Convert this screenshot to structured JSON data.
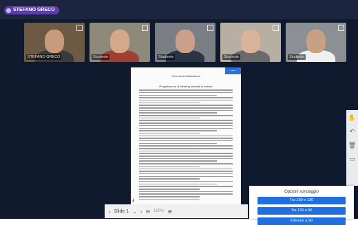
{
  "presenter": {
    "name": "STEFANO GRECO"
  },
  "participants": [
    {
      "name": "STEFANO GRECO",
      "bg": "#6d5a44",
      "skin": "#c89b7b",
      "shirt": "#3a3a3a"
    },
    {
      "name": "Studente",
      "bg": "#8d8a7c",
      "skin": "#d4a98a",
      "shirt": "#a04030"
    },
    {
      "name": "Studente",
      "bg": "#7a7f86",
      "skin": "#caa088",
      "shirt": "#2c3346"
    },
    {
      "name": "Studente",
      "bg": "#b7b0a2",
      "skin": "#d9b49a",
      "shirt": "#6a6a6a"
    },
    {
      "name": "Studente",
      "bg": "#8c8f93",
      "skin": "#c8a084",
      "shirt": "#f0f0f0"
    }
  ],
  "document": {
    "heading": "Percorsi di cittadinanza",
    "subheading": "Progettazione di Meeting orientati al settore",
    "tab_label": "—"
  },
  "toolbar": {
    "slide_label": "Slide 1",
    "zoom_label": "100%",
    "prev": "‹",
    "next": "›",
    "dropdown": "⌄"
  },
  "poll": {
    "title": "Opzioni sondaggio",
    "options": [
      "Tra 160 e 130",
      "Tra 130 e 90",
      "Inferiore a 90"
    ]
  },
  "side_tools": [
    "✋",
    "↶",
    "🗑",
    "▭"
  ],
  "colors": {
    "accent": "#1f6fe0",
    "stage_bg": "#101a2e",
    "presenter_badge": "#5b3fa8"
  }
}
